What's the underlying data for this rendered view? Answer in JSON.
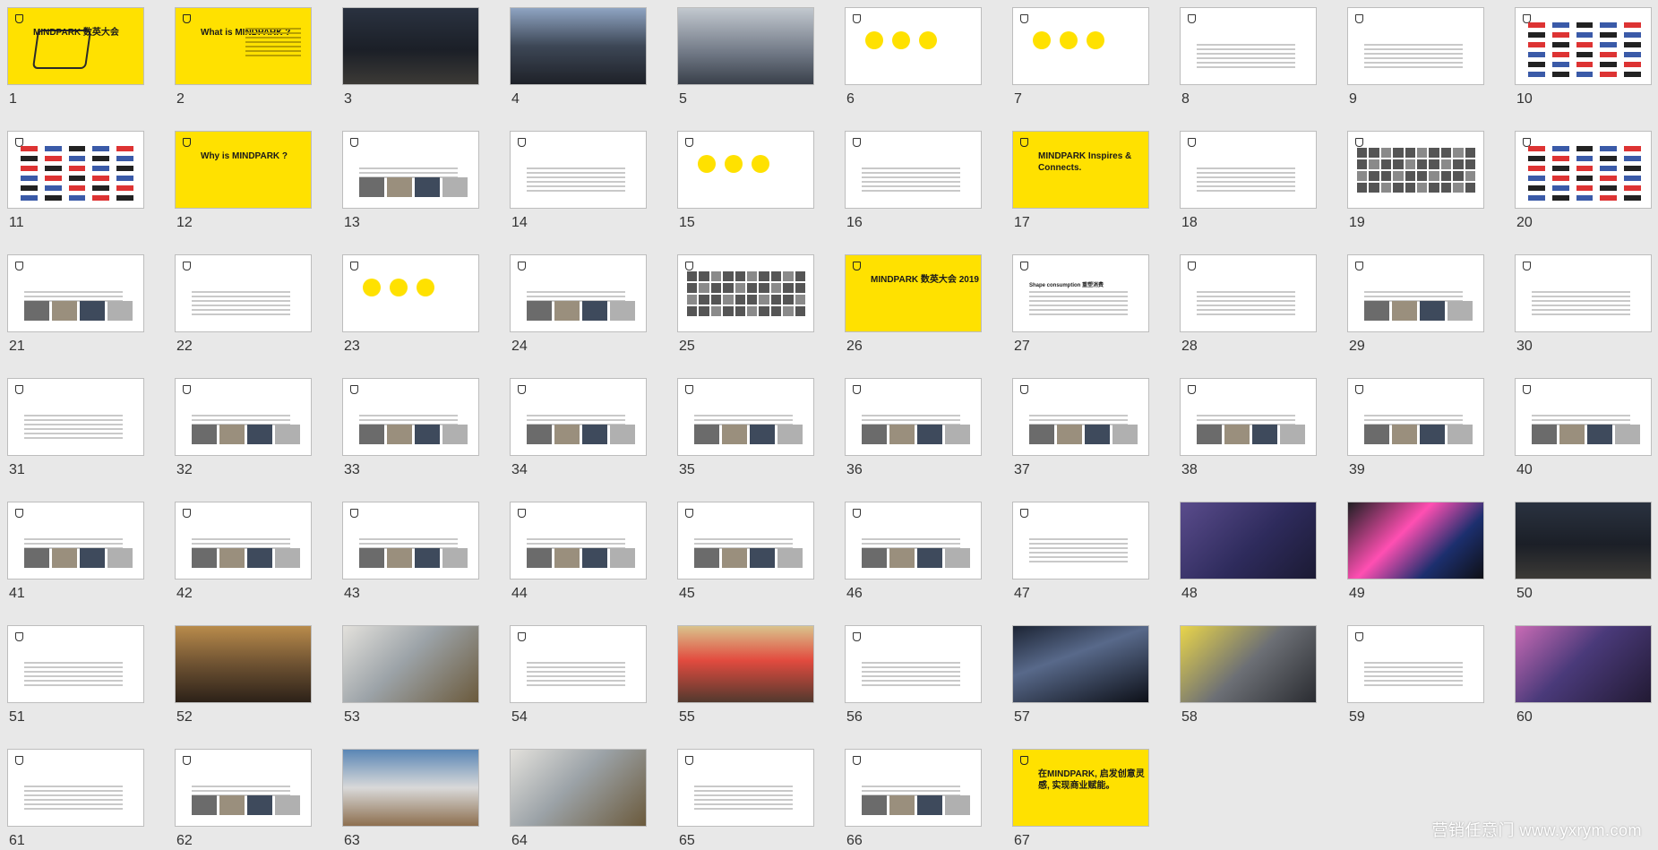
{
  "slides": [
    {
      "n": "1",
      "kind": "yellow",
      "title": "MINDPARK 数英大会"
    },
    {
      "n": "2",
      "kind": "yellow",
      "title": "What is MINDPARK ?"
    },
    {
      "n": "3",
      "kind": "photo",
      "ph": "ph1"
    },
    {
      "n": "4",
      "kind": "photo",
      "ph": "ph3"
    },
    {
      "n": "5",
      "kind": "photo",
      "ph": "ph5"
    },
    {
      "n": "6",
      "kind": "circles",
      "title": ""
    },
    {
      "n": "7",
      "kind": "circles",
      "title": ""
    },
    {
      "n": "8",
      "kind": "text",
      "title": ""
    },
    {
      "n": "9",
      "kind": "text",
      "title": ""
    },
    {
      "n": "10",
      "kind": "logos",
      "title": ""
    },
    {
      "n": "11",
      "kind": "logos",
      "title": ""
    },
    {
      "n": "12",
      "kind": "yellow",
      "title": "Why is MINDPARK ?"
    },
    {
      "n": "13",
      "kind": "textimg",
      "title": ""
    },
    {
      "n": "14",
      "kind": "text",
      "title": ""
    },
    {
      "n": "15",
      "kind": "circles",
      "title": ""
    },
    {
      "n": "16",
      "kind": "text",
      "title": ""
    },
    {
      "n": "17",
      "kind": "yellow",
      "title": "MINDPARK Inspires & Connects."
    },
    {
      "n": "18",
      "kind": "text",
      "title": ""
    },
    {
      "n": "19",
      "kind": "faces",
      "title": ""
    },
    {
      "n": "20",
      "kind": "logos",
      "title": ""
    },
    {
      "n": "21",
      "kind": "textimg",
      "title": ""
    },
    {
      "n": "22",
      "kind": "text",
      "title": ""
    },
    {
      "n": "23",
      "kind": "circles",
      "title": ""
    },
    {
      "n": "24",
      "kind": "textimg",
      "title": ""
    },
    {
      "n": "25",
      "kind": "faces",
      "title": ""
    },
    {
      "n": "26",
      "kind": "yellow",
      "title": "MINDPARK 数英大会 2019"
    },
    {
      "n": "27",
      "kind": "text",
      "title": "Shape consumption 重塑消费"
    },
    {
      "n": "28",
      "kind": "text",
      "title": ""
    },
    {
      "n": "29",
      "kind": "textimg",
      "title": ""
    },
    {
      "n": "30",
      "kind": "text",
      "title": ""
    },
    {
      "n": "31",
      "kind": "text",
      "title": ""
    },
    {
      "n": "32",
      "kind": "textimg",
      "title": ""
    },
    {
      "n": "33",
      "kind": "textimg",
      "title": ""
    },
    {
      "n": "34",
      "kind": "textimg",
      "title": ""
    },
    {
      "n": "35",
      "kind": "textimg",
      "title": ""
    },
    {
      "n": "36",
      "kind": "textimg",
      "title": ""
    },
    {
      "n": "37",
      "kind": "textimg",
      "title": ""
    },
    {
      "n": "38",
      "kind": "textimg",
      "title": ""
    },
    {
      "n": "39",
      "kind": "textimg",
      "title": ""
    },
    {
      "n": "40",
      "kind": "textimg",
      "title": ""
    },
    {
      "n": "41",
      "kind": "textimg",
      "title": ""
    },
    {
      "n": "42",
      "kind": "textimg",
      "title": ""
    },
    {
      "n": "43",
      "kind": "textimg",
      "title": ""
    },
    {
      "n": "44",
      "kind": "textimg",
      "title": ""
    },
    {
      "n": "45",
      "kind": "textimg",
      "title": ""
    },
    {
      "n": "46",
      "kind": "textimg",
      "title": ""
    },
    {
      "n": "47",
      "kind": "text",
      "title": ""
    },
    {
      "n": "48",
      "kind": "photo",
      "ph": "ph2"
    },
    {
      "n": "49",
      "kind": "photo",
      "ph": "ph13"
    },
    {
      "n": "50",
      "kind": "photo",
      "ph": "ph1"
    },
    {
      "n": "51",
      "kind": "text",
      "title": ""
    },
    {
      "n": "52",
      "kind": "photo",
      "ph": "ph4"
    },
    {
      "n": "53",
      "kind": "photo",
      "ph": "ph11"
    },
    {
      "n": "54",
      "kind": "text",
      "title": ""
    },
    {
      "n": "55",
      "kind": "photo",
      "ph": "ph6"
    },
    {
      "n": "56",
      "kind": "text",
      "title": ""
    },
    {
      "n": "57",
      "kind": "photo",
      "ph": "ph7"
    },
    {
      "n": "58",
      "kind": "photo",
      "ph": "ph8"
    },
    {
      "n": "59",
      "kind": "text",
      "title": ""
    },
    {
      "n": "60",
      "kind": "photo",
      "ph": "ph9"
    },
    {
      "n": "61",
      "kind": "text",
      "title": ""
    },
    {
      "n": "62",
      "kind": "textimg",
      "title": ""
    },
    {
      "n": "63",
      "kind": "photo",
      "ph": "ph10"
    },
    {
      "n": "64",
      "kind": "photo",
      "ph": "ph11"
    },
    {
      "n": "65",
      "kind": "text",
      "title": ""
    },
    {
      "n": "66",
      "kind": "textimg",
      "title": ""
    },
    {
      "n": "67",
      "kind": "yellow",
      "title": "在MINDPARK, 启发创意灵感, 实现商业赋能。"
    }
  ],
  "watermark": "营销任意门 www.yxrym.com"
}
